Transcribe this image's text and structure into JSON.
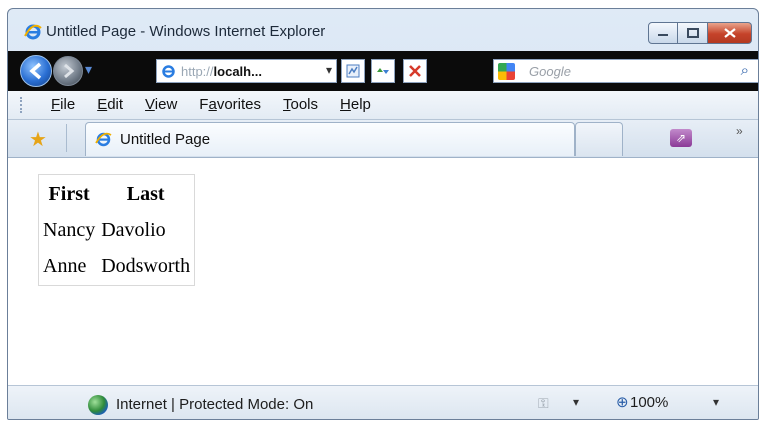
{
  "window": {
    "title": "Untitled Page - Windows Internet Explorer"
  },
  "navigation": {
    "address": {
      "prefix": "http://",
      "host": "localh...",
      "dropdown": "▾"
    },
    "nav_dropdown": "▾",
    "toolbar_icons": [
      "compatibility-icon",
      "refresh-icon",
      "stop-icon"
    ],
    "search": {
      "placeholder": "Google",
      "go_icon": "⌕"
    }
  },
  "menu": {
    "items": [
      {
        "key": "F",
        "rest": "ile"
      },
      {
        "key": "E",
        "rest": "dit"
      },
      {
        "key": "V",
        "rest": "iew"
      },
      {
        "pre": "F",
        "key": "a",
        "rest": "vorites"
      },
      {
        "key": "T",
        "rest": "ools"
      },
      {
        "key": "H",
        "rest": "elp"
      }
    ]
  },
  "tabs": {
    "active_title": "Untitled Page",
    "overflow": "»"
  },
  "page": {
    "table": {
      "headers": [
        "First",
        "Last"
      ],
      "rows": [
        [
          "Nancy",
          "Davolio"
        ],
        [
          "Anne",
          "Dodsworth"
        ]
      ]
    }
  },
  "status": {
    "zone": "Internet | Protected Mode: On",
    "zoom": "100%",
    "dropdown": "▾"
  }
}
